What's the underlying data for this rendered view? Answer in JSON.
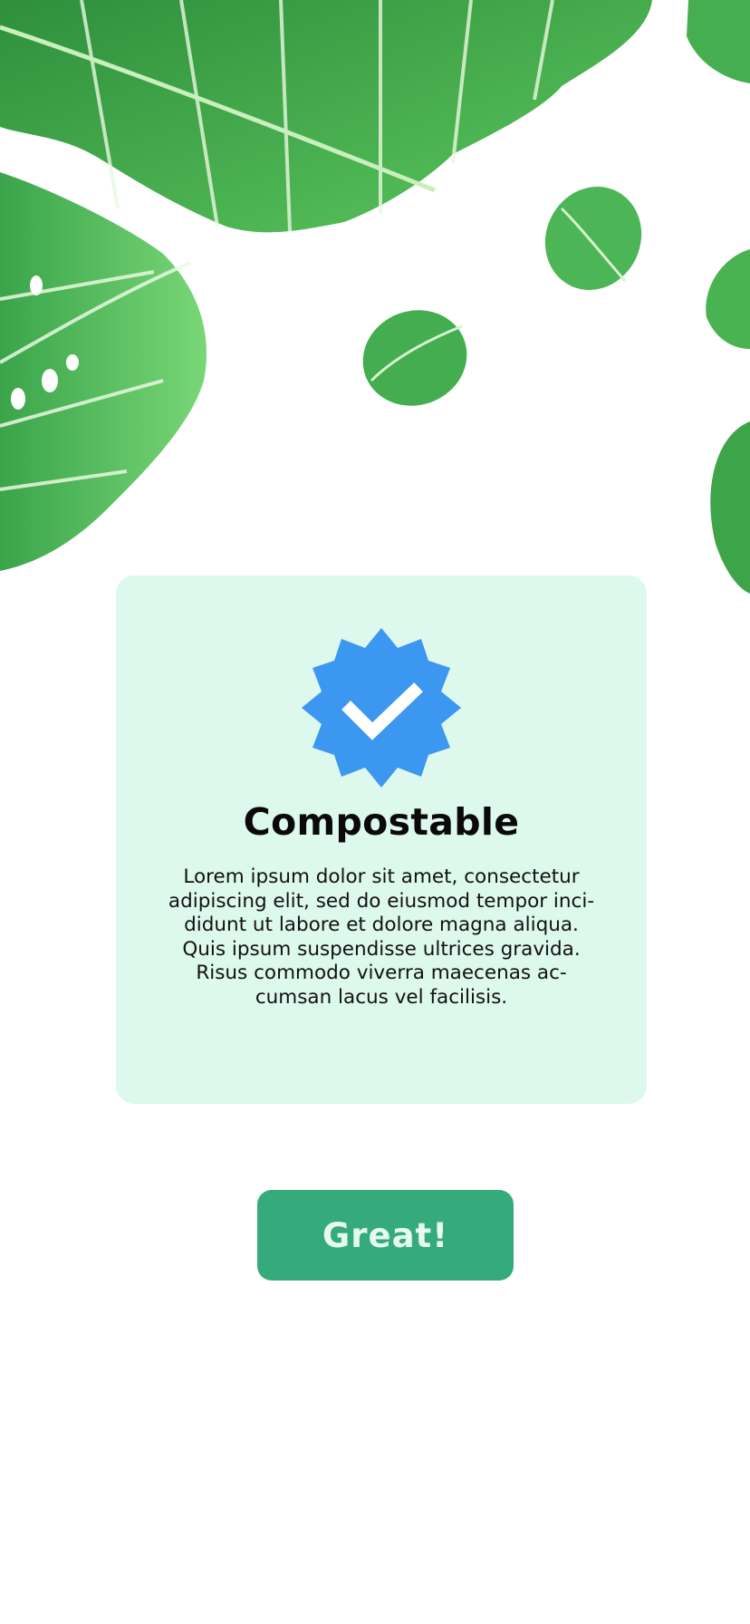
{
  "colors": {
    "card_background": "#ddf8ec",
    "badge_blue": "#3c97f1",
    "button_green": "#35ab7b",
    "leaf_green": "#3fa54a"
  },
  "illustration": {
    "name": "monstera-leaves-decoration"
  },
  "badge": {
    "icon": "verified-check-icon"
  },
  "card": {
    "title": "Compostable",
    "body_lines": [
      "Lorem ipsum dolor sit amet, consectetur",
      "adipiscing elit, sed do eiusmod tempor inci-",
      "didunt ut labore et dolore magna aliqua.",
      "Quis ipsum suspendisse ultrices gravida.",
      "Risus commodo viverra maecenas ac-",
      "cumsan lacus vel facilisis."
    ]
  },
  "primary_button": {
    "label": "Great!"
  }
}
